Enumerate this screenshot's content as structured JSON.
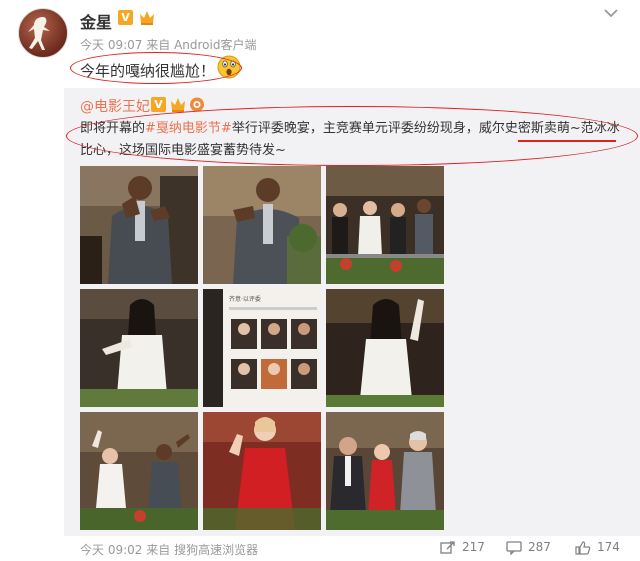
{
  "post": {
    "username": "金星",
    "v_badge": "V",
    "timestamp": "今天 09:07",
    "source_prefix": "来自",
    "source": "Android客户端",
    "text": "今年的嘎纳很尴尬！"
  },
  "repost": {
    "author": "@电影王妃",
    "v_badge": "V",
    "text_prefix": "即将开幕的",
    "hashtag": "#戛纳电影节#",
    "text_rest": "举行评委晚宴，主竞赛单元评委纷纷现身，威尔史密斯卖萌~范冰冰比心，这场国际电影盛宴蓄势待发~",
    "grid_note_title": "齐意·以评委",
    "footer": {
      "timestamp": "今天 09:02",
      "source_prefix": "来自",
      "source": "搜狗高速浏览器",
      "repost_count": "217",
      "comment_count": "287",
      "like_count": "174"
    }
  },
  "photos": [
    {
      "name": "photo-will-smith-1",
      "desc": "man in grey suit gesture"
    },
    {
      "name": "photo-will-smith-2",
      "desc": "man in grey suit gesture 2"
    },
    {
      "name": "photo-jury-group",
      "desc": "jury group on balcony"
    },
    {
      "name": "photo-fan-bingbing-heart",
      "desc": "woman in white heart gesture"
    },
    {
      "name": "photo-jury-grid",
      "desc": "jury portraits grid"
    },
    {
      "name": "photo-fan-bingbing-wave",
      "desc": "woman in white waving"
    },
    {
      "name": "photo-jury-waving",
      "desc": "jury waving on balcony"
    },
    {
      "name": "photo-red-dress",
      "desc": "woman in red dress waving"
    },
    {
      "name": "photo-jury-trio",
      "desc": "three jury members"
    }
  ],
  "icons": {
    "repost": "repost-icon",
    "comment": "comment-icon",
    "like": "like-icon",
    "more": "chevron-down-icon"
  },
  "colors": {
    "accent_orange": "#eb7350",
    "annotation_red": "#e02020",
    "v_gold": "#f5a623"
  }
}
